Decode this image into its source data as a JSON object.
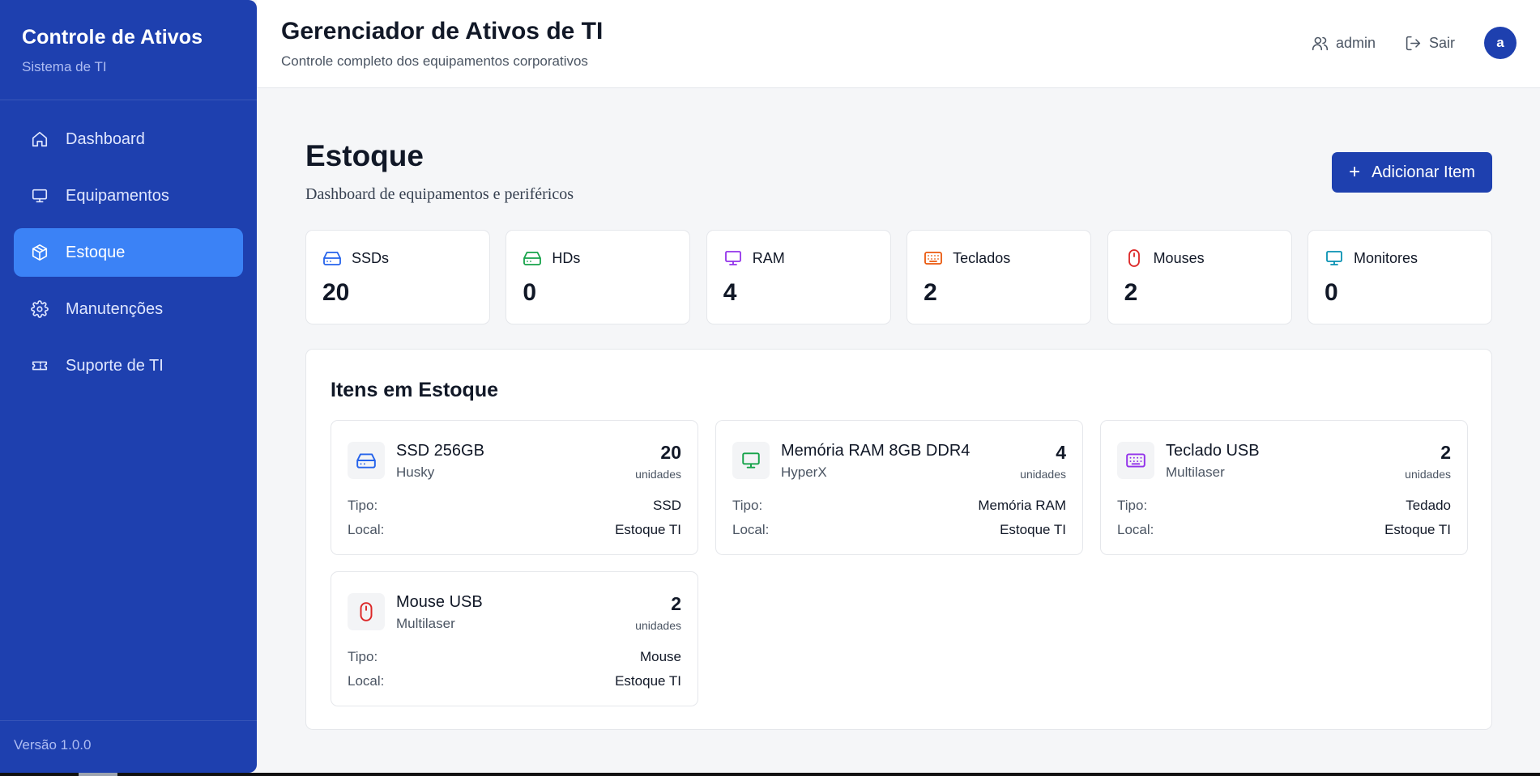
{
  "sidebar": {
    "title": "Controle de Ativos",
    "subtitle": "Sistema de TI",
    "items": [
      {
        "label": "Dashboard",
        "icon": "home-icon"
      },
      {
        "label": "Equipamentos",
        "icon": "monitor-icon"
      },
      {
        "label": "Estoque",
        "icon": "package-icon",
        "active": true
      },
      {
        "label": "Manutenções",
        "icon": "gear-icon"
      },
      {
        "label": "Suporte de TI",
        "icon": "ticket-icon"
      }
    ],
    "version": "Versão 1.0.0"
  },
  "header": {
    "title": "Gerenciador de Ativos de TI",
    "subtitle": "Controle completo dos equipamentos corporativos",
    "user_label": "admin",
    "logout_label": "Sair",
    "avatar_letter": "a"
  },
  "page": {
    "title": "Estoque",
    "subtitle": "Dashboard de equipamentos e periféricos",
    "add_button_label": "Adicionar Item"
  },
  "stats": [
    {
      "label": "SSDs",
      "value": "20",
      "icon": "hard-drive-icon",
      "color": "#2563eb"
    },
    {
      "label": "HDs",
      "value": "0",
      "icon": "hard-drive-icon",
      "color": "#16a34a"
    },
    {
      "label": "RAM",
      "value": "4",
      "icon": "monitor-icon",
      "color": "#9333ea"
    },
    {
      "label": "Teclados",
      "value": "2",
      "icon": "keyboard-icon",
      "color": "#ea580c"
    },
    {
      "label": "Mouses",
      "value": "2",
      "icon": "mouse-icon",
      "color": "#dc2626"
    },
    {
      "label": "Monitores",
      "value": "0",
      "icon": "monitor-icon",
      "color": "#0891b2"
    }
  ],
  "inventory": {
    "title": "Itens em Estoque",
    "type_label": "Tipo:",
    "location_label": "Local:",
    "units_label": "unidades",
    "items": [
      {
        "name": "SSD 256GB",
        "brand": "Husky",
        "qty": "20",
        "type": "SSD",
        "location": "Estoque TI",
        "icon": "hard-drive-icon",
        "color": "#2563eb"
      },
      {
        "name": "Memória RAM 8GB DDR4",
        "brand": "HyperX",
        "qty": "4",
        "type": "Memória RAM",
        "location": "Estoque TI",
        "icon": "monitor-icon",
        "color": "#16a34a"
      },
      {
        "name": "Teclado USB",
        "brand": "Multilaser",
        "qty": "2",
        "type": "Tedado",
        "location": "Estoque TI",
        "icon": "keyboard-icon",
        "color": "#9333ea"
      },
      {
        "name": "Mouse USB",
        "brand": "Multilaser",
        "qty": "2",
        "type": "Mouse",
        "location": "Estoque TI",
        "icon": "mouse-icon",
        "color": "#dc2626"
      }
    ]
  }
}
